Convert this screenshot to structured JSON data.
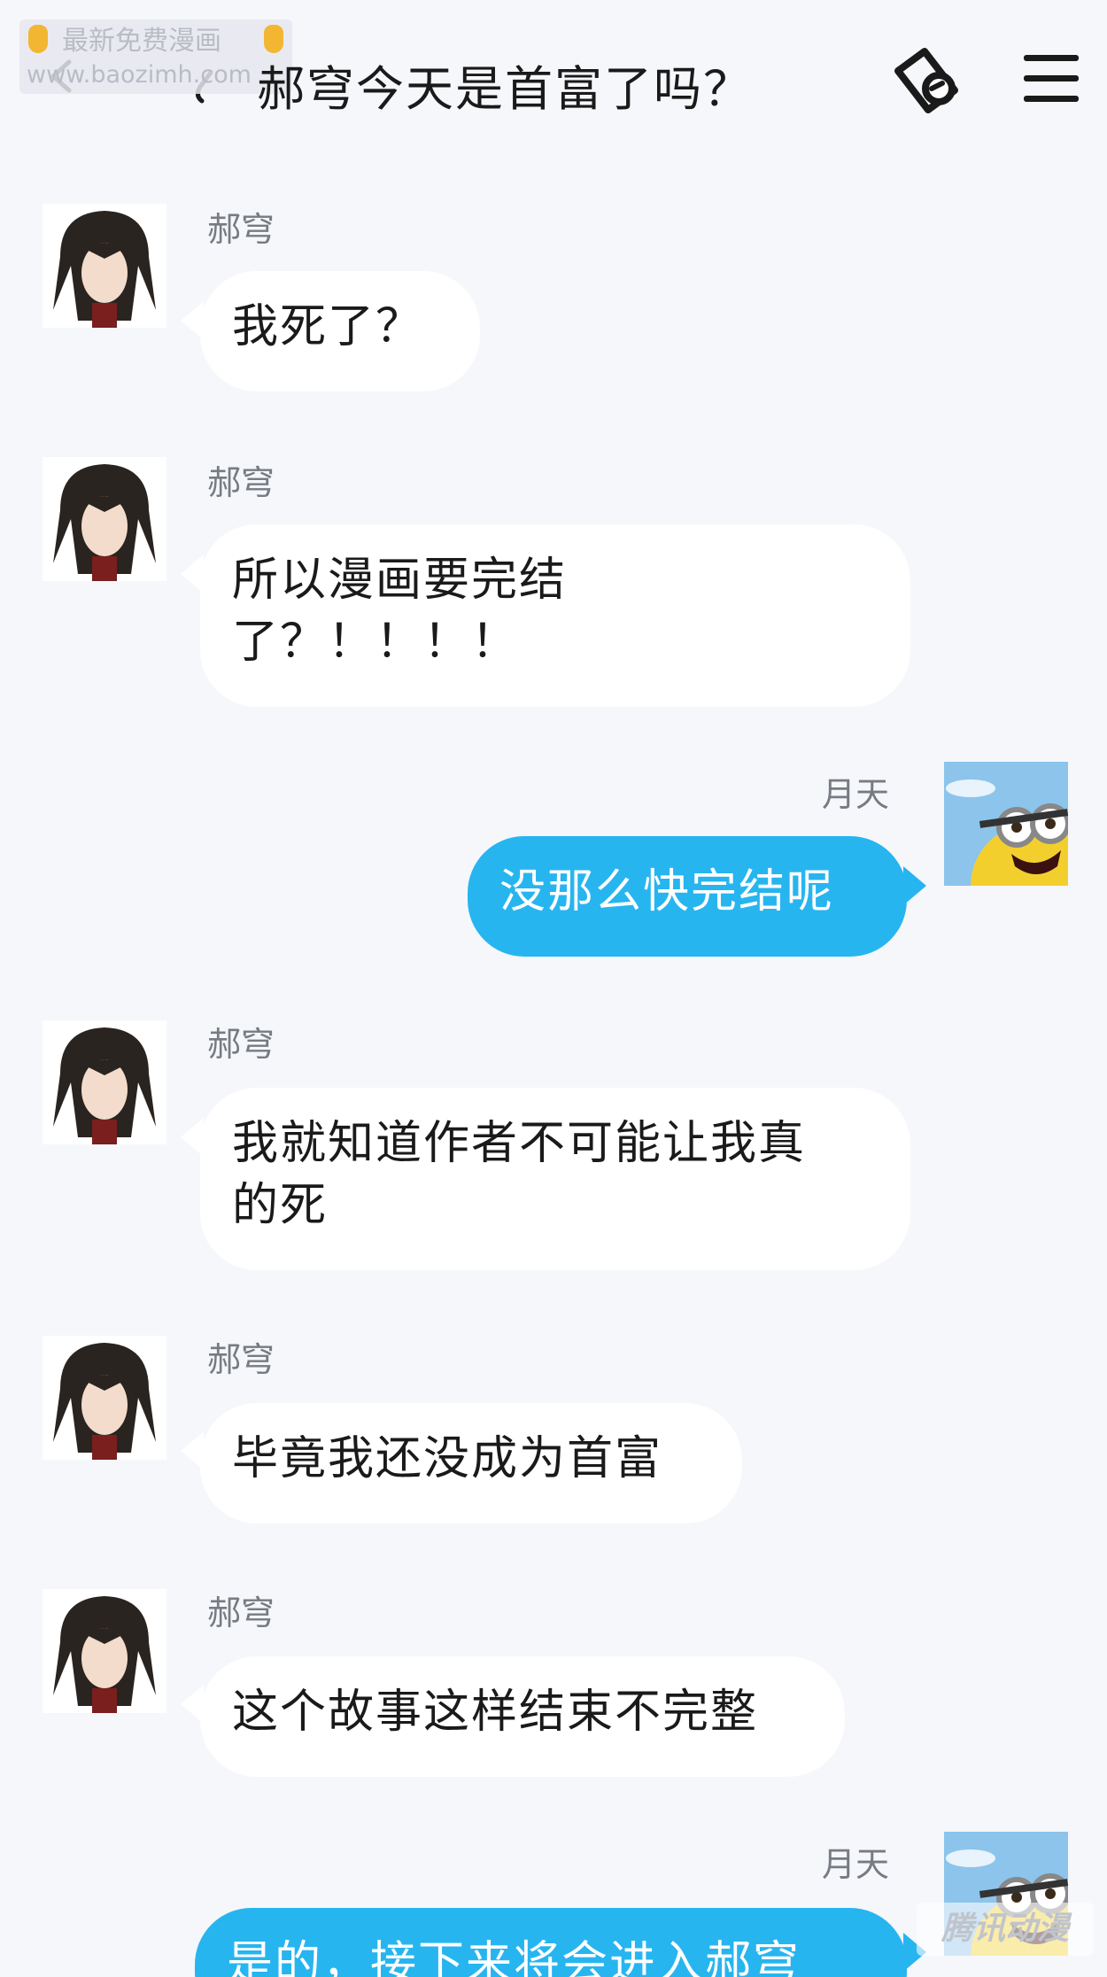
{
  "header": {
    "title": "郝穹今天是首富了吗？",
    "watermark_line1": "最新免费漫画",
    "watermark_line2": "www.baozimh.com"
  },
  "icons": {
    "back": "back-arrow-icon",
    "link": "link-icon",
    "ticket": "ticket-link-icon",
    "menu": "menu-icon"
  },
  "messages": [
    {
      "sender": "郝穹",
      "side": "left",
      "text": "我死了？"
    },
    {
      "sender": "郝穹",
      "side": "left",
      "text": "所以漫画要完结\n了？！！！！"
    },
    {
      "sender": "月天",
      "side": "right",
      "text": "没那么快完结呢"
    },
    {
      "sender": "郝穹",
      "side": "left",
      "text": "我就知道作者不可能让我真\n的死"
    },
    {
      "sender": "郝穹",
      "side": "left",
      "text": "毕竟我还没成为首富"
    },
    {
      "sender": "郝穹",
      "side": "left",
      "text": "这个故事这样结束不完整"
    },
    {
      "sender": "月天",
      "side": "right",
      "text": "是的，接下来将会进入郝穹"
    }
  ],
  "colors": {
    "background": "#f5f7fb",
    "bubble_left": "#ffffff",
    "bubble_right": "#27b5f0",
    "sender_gray": "#777b82"
  },
  "corner_logo": "腾讯动漫"
}
